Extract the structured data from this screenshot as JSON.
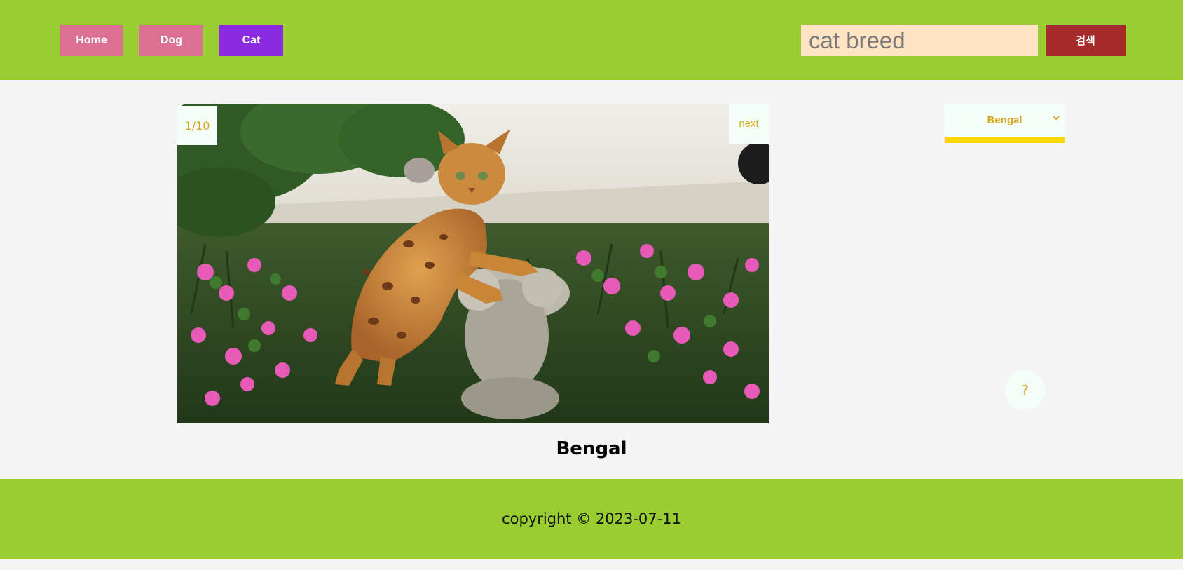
{
  "nav": {
    "home_label": "Home",
    "dog_label": "Dog",
    "cat_label": "Cat"
  },
  "search": {
    "value": "cat breed",
    "button_label": "검색"
  },
  "gallery": {
    "counter": "1/10",
    "next_label": "next",
    "breed_name": "Bengal"
  },
  "breed_select": {
    "selected": "Bengal",
    "chevron_icon": "chevron-down-icon"
  },
  "help": {
    "label": "?"
  },
  "footer": {
    "copyright": "copyright © 2023-07-11"
  },
  "colors": {
    "header_bg": "#9acd32",
    "nav_default": "#db7093",
    "nav_active": "#8a2be2",
    "search_bg": "#ffe4c4",
    "search_btn": "#a52a2a",
    "accent_text": "#daa520",
    "select_underline": "#ffd700"
  }
}
